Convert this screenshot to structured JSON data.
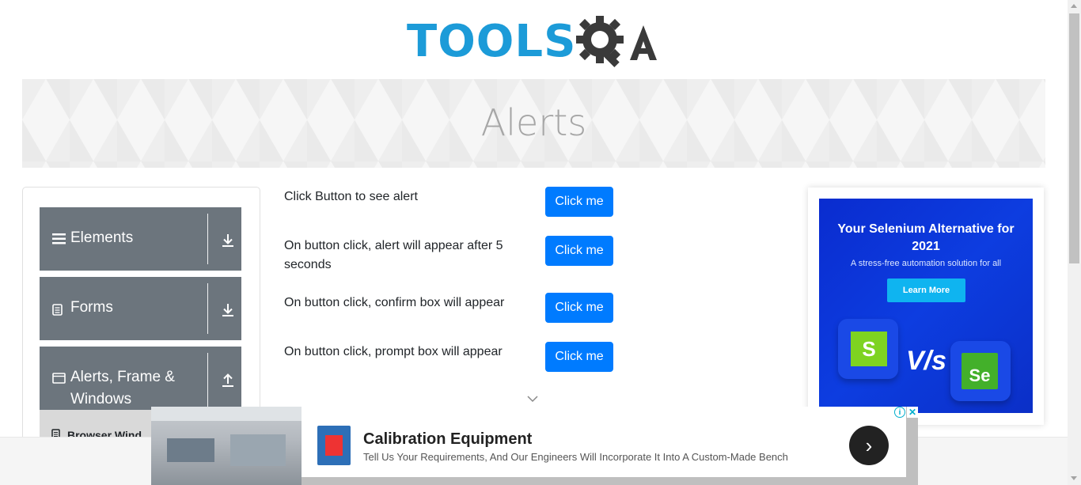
{
  "logo": {
    "part1": "TOOLS",
    "part2": "QA"
  },
  "banner": {
    "title": "Alerts"
  },
  "sidebar": {
    "groups": [
      {
        "label": "Elements",
        "icon": "hamburger-icon",
        "toggle": "download-icon"
      },
      {
        "label": "Forms",
        "icon": "document-icon",
        "toggle": "download-icon"
      },
      {
        "label": "Alerts, Frame & Windows",
        "icon": "window-icon",
        "toggle": "upload-icon"
      }
    ],
    "sub_item": {
      "label": "Browser Wind",
      "icon": "document-icon"
    }
  },
  "alerts": {
    "rows": [
      {
        "label": "Click Button to see alert",
        "button": "Click me"
      },
      {
        "label": "On button click, alert will appear after 5 seconds",
        "button": "Click me"
      },
      {
        "label": "On button click, confirm box will appear",
        "button": "Click me"
      },
      {
        "label": "On button click, prompt box will appear",
        "button": "Click me"
      }
    ]
  },
  "right_ad": {
    "title": "Your Selenium Alternative for 2021",
    "subtitle": "A stress-free automation solution for all",
    "button": "Learn More",
    "vs": "V/s",
    "logo_s": "S",
    "logo_se": "Se"
  },
  "bottom_ad": {
    "title": "Calibration Equipment",
    "subtitle": "Tell Us Your Requirements, And Our Engineers Will Incorporate It Into A Custom-Made Bench",
    "info": "i",
    "close": "✕",
    "arrow": "›"
  },
  "colors": {
    "primary_button": "#007bff",
    "sidebar_group": "#6c757d",
    "logo_blue": "#1c9bd8"
  }
}
